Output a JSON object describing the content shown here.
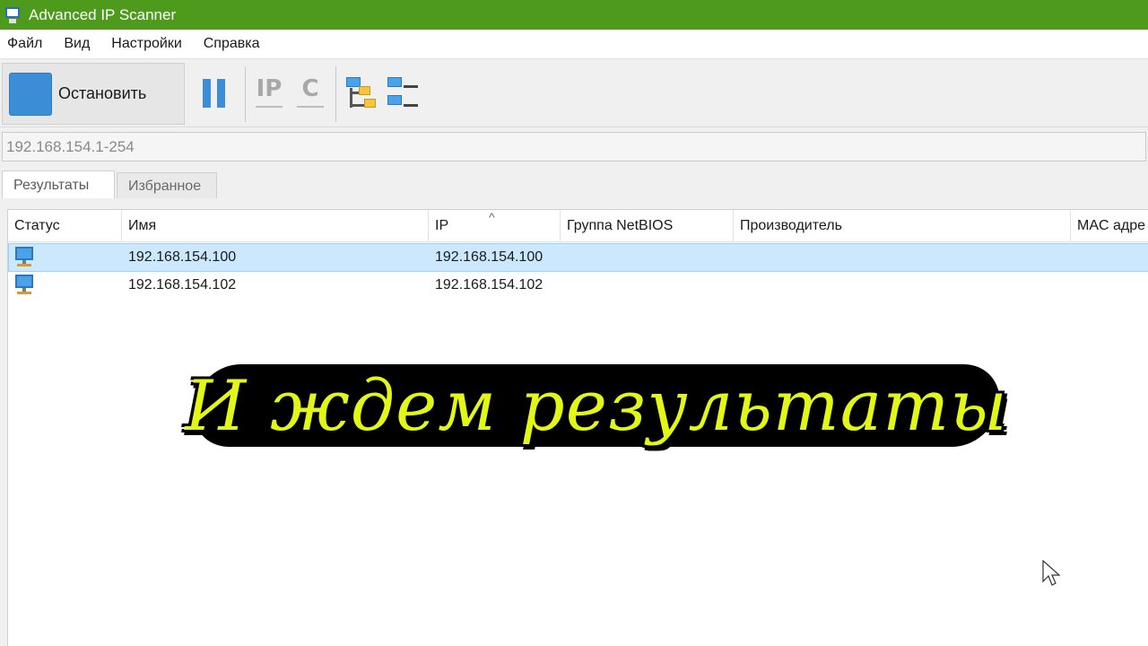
{
  "window": {
    "title": "Advanced IP Scanner"
  },
  "menu": {
    "items": [
      "Файл",
      "Вид",
      "Настройки",
      "Справка"
    ]
  },
  "toolbar": {
    "stop_label": "Остановить",
    "ip_icon_text": "IP",
    "c_icon_text": "C"
  },
  "address": {
    "value": "192.168.154.1-254"
  },
  "tabs": {
    "results": "Результаты",
    "favorites": "Избранное"
  },
  "grid": {
    "columns": [
      "Статус",
      "Имя",
      "IP",
      "Группа NetBIOS",
      "Производитель",
      "MAC адре"
    ],
    "sort_indicator": "^",
    "rows": [
      {
        "name": "192.168.154.100",
        "ip": "192.168.154.100"
      },
      {
        "name": "192.168.154.102",
        "ip": "192.168.154.102"
      }
    ]
  },
  "caption": {
    "text": "И ждем результаты"
  },
  "colors": {
    "titlebar": "#4e9a1c",
    "accent": "#3b8ed6",
    "selection": "#cce8ff",
    "caption_fill": "#e2f716"
  }
}
